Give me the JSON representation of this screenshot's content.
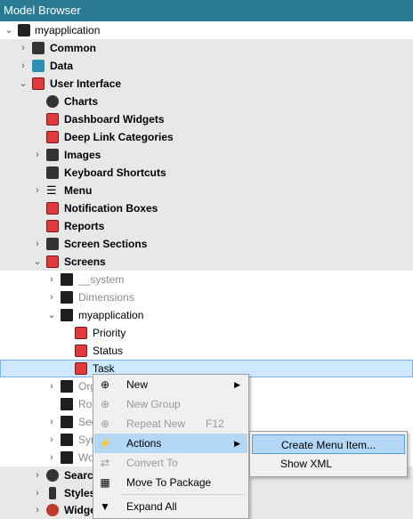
{
  "window": {
    "title": "Model Browser"
  },
  "tree": {
    "root": "myapplication",
    "common": "Common",
    "data": "Data",
    "ui": "User Interface",
    "charts": "Charts",
    "dashboard_widgets": "Dashboard Widgets",
    "deep_link_categories": "Deep Link Categories",
    "images": "Images",
    "keyboard_shortcuts": "Keyboard Shortcuts",
    "menu": "Menu",
    "notification_boxes": "Notification Boxes",
    "reports": "Reports",
    "screen_sections": "Screen Sections",
    "screens": "Screens",
    "system": "__system",
    "dimensions": "Dimensions",
    "myapplication_folder": "myapplication",
    "priority": "Priority",
    "status": "Status",
    "task": "Task",
    "org_partial": "Org",
    "rou_partial": "Rou",
    "sec_partial": "Sec",
    "sym_partial": "Sym",
    "wo_partial": "Wo",
    "search_partial": "Searc",
    "styles_partial": "Styles",
    "widge_partial": "Widge"
  },
  "context_menu": {
    "new": "New",
    "new_group": "New Group",
    "repeat_new": "Repeat New",
    "repeat_new_key": "F12",
    "actions": "Actions",
    "convert_to": "Convert To",
    "move_to_package": "Move To Package",
    "expand_all": "Expand All"
  },
  "submenu": {
    "create_menu_item": "Create Menu Item...",
    "show_xml": "Show XML"
  },
  "colors": {
    "titlebar": "#2a7a93",
    "selection": "#cde8ff",
    "menu_highlight": "#b3d7f5"
  }
}
